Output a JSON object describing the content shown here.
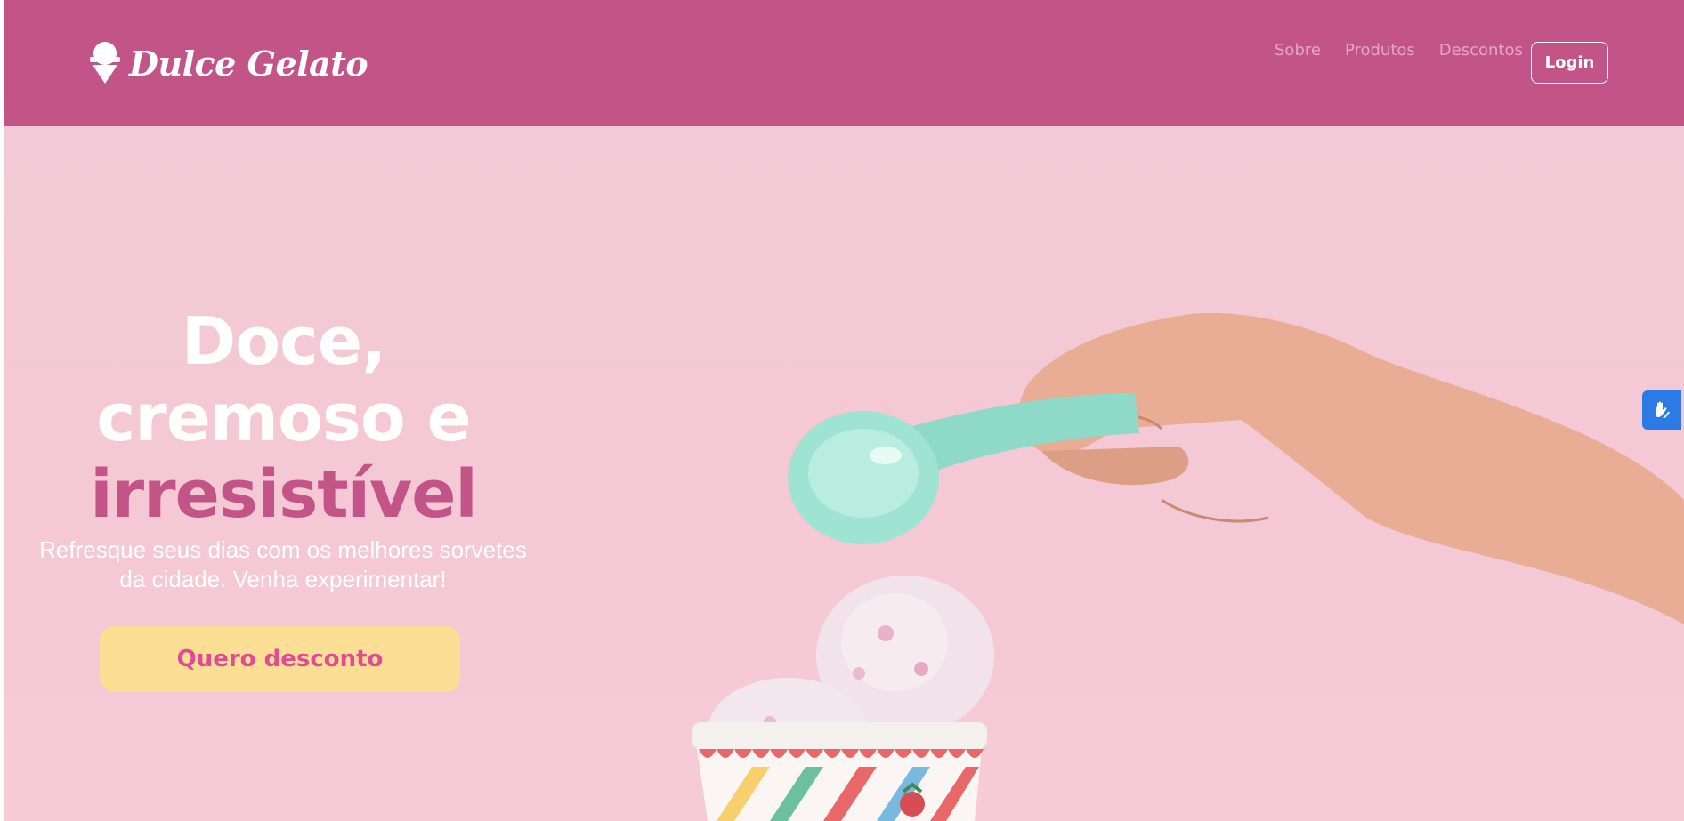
{
  "header": {
    "brand_name": "Dulce Gelato",
    "nav": [
      {
        "label": "Sobre"
      },
      {
        "label": "Produtos"
      },
      {
        "label": "Descontos"
      }
    ],
    "login_label": "Login"
  },
  "hero": {
    "headline_1": "Doce,",
    "headline_2": "cremoso e",
    "headline_3": "irresistível",
    "subtitle": "Refresque seus dias com os melhores sorvetes da cidade. Venha experimentar!",
    "cta_label": "Quero desconto"
  },
  "accessibility_widget": {
    "icon": "sign-language-hands-icon"
  },
  "colors": {
    "header_bg": "#c25487",
    "hero_bg": "#f4c8d4",
    "accent": "#c25487",
    "cta_bg": "#fcde94",
    "cta_text": "#e04b93",
    "widget_bg": "#2c7be5"
  }
}
